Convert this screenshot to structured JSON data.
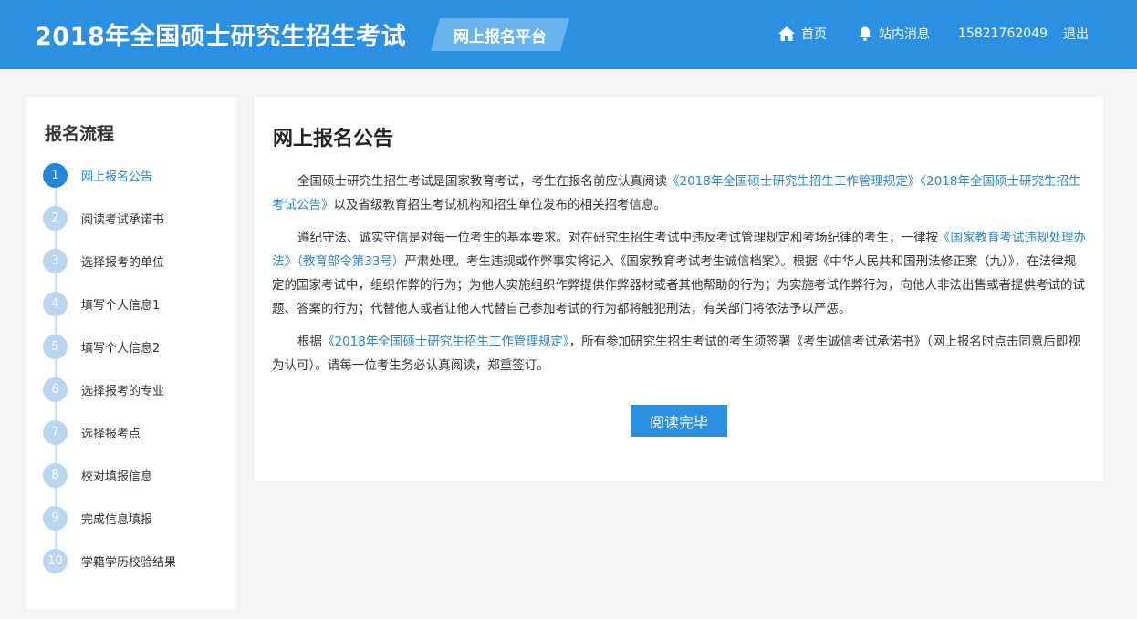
{
  "header": {
    "title": "2018年全国硕士研究生招生考试",
    "platform": "网上报名平台",
    "nav": {
      "home": "首页",
      "messages": "站内消息",
      "phone": "15821762049",
      "logout": "退出"
    }
  },
  "sidebar": {
    "title": "报名流程",
    "steps": [
      {
        "num": "1",
        "label": "网上报名公告"
      },
      {
        "num": "2",
        "label": "阅读考试承诺书"
      },
      {
        "num": "3",
        "label": "选择报考的单位"
      },
      {
        "num": "4",
        "label": "填写个人信息1"
      },
      {
        "num": "5",
        "label": "填写个人信息2"
      },
      {
        "num": "6",
        "label": "选择报考的专业"
      },
      {
        "num": "7",
        "label": "选择报考点"
      },
      {
        "num": "8",
        "label": "校对填报信息"
      },
      {
        "num": "9",
        "label": "完成信息填报"
      },
      {
        "num": "10",
        "label": "学籍学历校验结果"
      }
    ]
  },
  "main": {
    "title": "网上报名公告",
    "p1": {
      "t1": "全国硕士研究生招生考试是国家教育考试，考生在报名前应认真阅读",
      "link1": "《2018年全国硕士研究生招生工作管理规定》",
      "link2": "《2018年全国硕士研究生招生考试公告》",
      "t2": "以及省级教育招生考试机构和招生单位发布的相关招考信息。"
    },
    "p2": {
      "t1": "遵纪守法、诚实守信是对每一位考生的基本要求。对在研究生招生考试中违反考试管理规定和考场纪律的考生，一律按",
      "link1": "《国家教育考试违规处理办法》（教育部令第33号）",
      "t2": "严肃处理。考生违规或作弊事实将记入《国家教育考试考生诚信档案》。根据《中华人民共和国刑法修正案（九）》，在法律规定的国家考试中，组织作弊的行为；为他人实施组织作弊提供作弊器材或者其他帮助的行为；为实施考试作弊行为，向他人非法出售或者提供考试的试题、答案的行为；代替他人或者让他人代替自己参加考试的行为都将触犯刑法，有关部门将依法予以严惩。"
    },
    "p3": {
      "t1": "根据",
      "link1": "《2018年全国硕士研究生招生工作管理规定》",
      "t2": "，所有参加研究生招生考试的考生须签署《考生诚信考试承诺书》（网上报名时点击同意后即视为认可）。请每一位考生务必认真阅读，郑重签订。"
    },
    "button": "阅读完毕"
  },
  "colors": {
    "header_bg": "#2b90e1",
    "badge_bg": "#68b5ec",
    "active_step": "#1f86d9",
    "inactive_step": "#b9d6ee",
    "link": "#2b86cf",
    "page_bg": "#f3f3f3"
  },
  "icons": {
    "home": "home-icon",
    "messages": "bell-icon"
  }
}
